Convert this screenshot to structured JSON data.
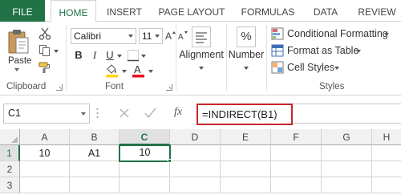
{
  "tabs": [
    "FILE",
    "HOME",
    "INSERT",
    "PAGE LAYOUT",
    "FORMULAS",
    "DATA",
    "REVIEW"
  ],
  "active_tab": "HOME",
  "colors": {
    "excel_green": "#217346",
    "highlight_red": "#c8262b",
    "font_color_red": "#e81123",
    "fill_yellow": "#ffd800"
  },
  "clipboard": {
    "paste_label": "Paste",
    "group_label": "Clipboard",
    "icons": [
      "clipboard-icon",
      "cut-icon",
      "copy-icon",
      "format-painter-icon"
    ]
  },
  "font": {
    "name": "Calibri",
    "size": "11",
    "bold": "B",
    "italic": "I",
    "underline": "U",
    "font_color_glyph": "A",
    "group_label": "Font"
  },
  "alignment": {
    "label": "Alignment"
  },
  "number": {
    "label": "Number",
    "icon_glyph": "%"
  },
  "styles": {
    "conditional_formatting": "Conditional Formatting",
    "format_as_table": "Format as Table",
    "cell_styles": "Cell Styles",
    "group_label": "Styles"
  },
  "formula_bar": {
    "name_box": "C1",
    "fx": "fx",
    "formula": "=INDIRECT(B1)"
  },
  "grid": {
    "columns": [
      "A",
      "B",
      "C",
      "D",
      "E",
      "F",
      "G",
      "H"
    ],
    "rows": [
      "1",
      "2",
      "3"
    ],
    "active_column": "C",
    "active_row": "1",
    "cells": {
      "A1": "10",
      "B1": "A1",
      "C1": "10"
    }
  }
}
